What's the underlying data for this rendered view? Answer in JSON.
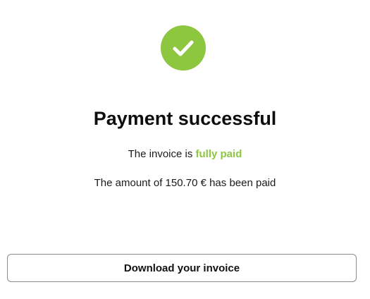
{
  "colors": {
    "success_green": "#8dc63f",
    "button_border": "#8c8c8c",
    "text": "#111111"
  },
  "status_icon": "checkmark-circle-icon",
  "title": "Payment successful",
  "invoice_status": {
    "prefix": "The invoice is",
    "highlight": "fully paid"
  },
  "amount_text": "The amount of 150.70 € has been paid",
  "download_button": {
    "label": "Download your invoice"
  }
}
